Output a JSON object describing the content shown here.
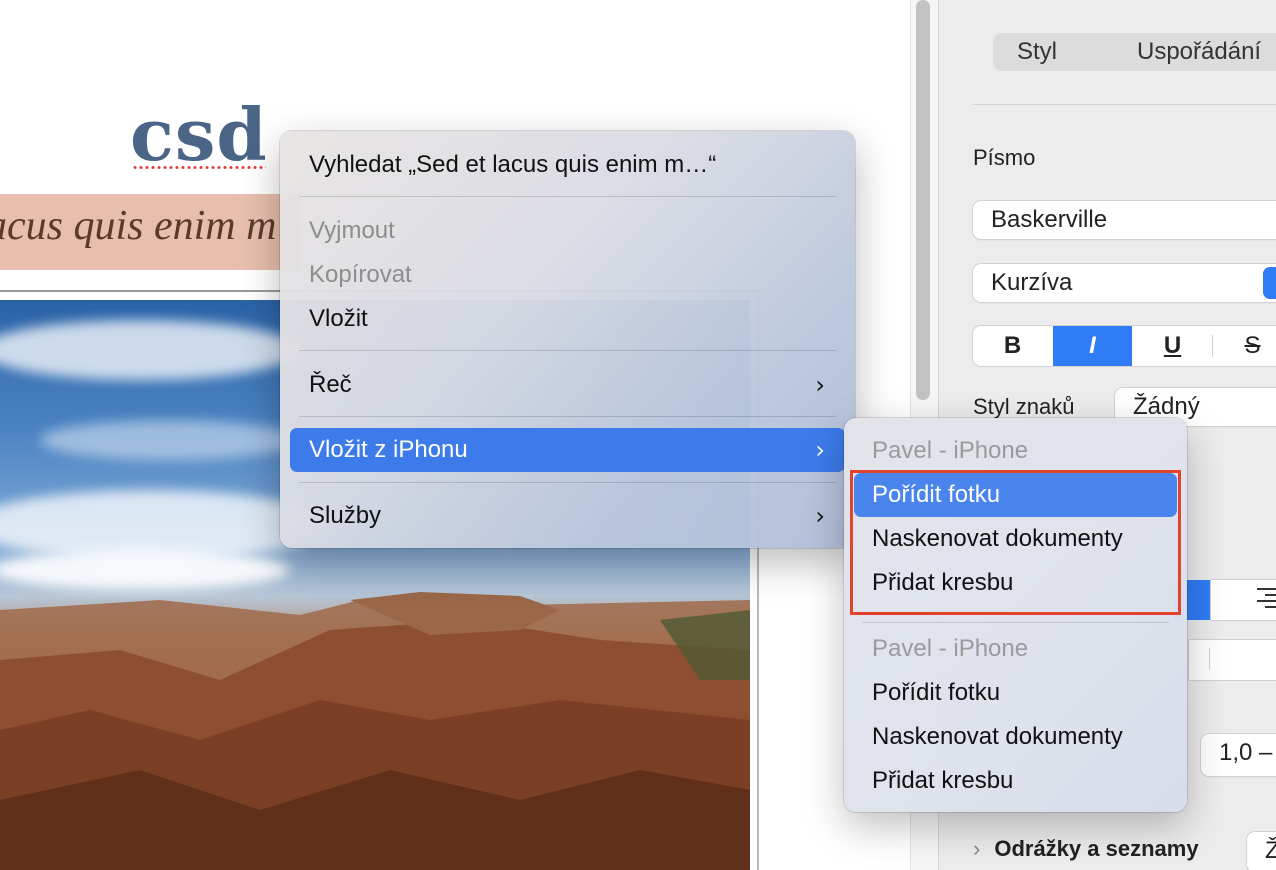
{
  "document": {
    "heading_word": "csd",
    "quote_text": "acus quis enim m"
  },
  "inspector": {
    "tabs": [
      "Styl",
      "Uspořádání"
    ],
    "font_section_label": "Písmo",
    "font_family": "Baskerville",
    "font_typeface": "Kurzíva",
    "format_buttons": [
      "B",
      "I",
      "U",
      "S"
    ],
    "char_style_label": "Styl znaků",
    "char_style_value": "Žádný",
    "spacing_value": "1,0 –",
    "bullets_label": "Odrážky a seznamy",
    "bullets_value": "Ž",
    "colors": {
      "accent": "#2f7cf6",
      "panel": "#ececec"
    }
  },
  "context_menu": {
    "items": [
      {
        "label": "Vyhledat „Sed et lacus quis enim m…“",
        "enabled": true
      },
      {
        "label": "Vyjmout",
        "enabled": false
      },
      {
        "label": "Kopírovat",
        "enabled": false
      },
      {
        "label": "Vložit",
        "enabled": true
      },
      {
        "label": "Řeč",
        "enabled": true,
        "submenu": true
      },
      {
        "label": "Vložit z iPhonu",
        "enabled": true,
        "submenu": true,
        "highlighted": true
      },
      {
        "label": "Služby",
        "enabled": true,
        "submenu": true
      }
    ],
    "chevron": "›"
  },
  "submenu": {
    "groups": [
      {
        "device": "Pavel - iPhone",
        "actions": [
          "Pořídit fotku",
          "Naskenovat dokumenty",
          "Přidat kresbu"
        ]
      },
      {
        "device": "Pavel - iPhone",
        "actions": [
          "Pořídit fotku",
          "Naskenovat dokumenty",
          "Přidat kresbu"
        ]
      }
    ],
    "highlight_color": "#4a85ee",
    "annotation_color": "#e2432f"
  }
}
